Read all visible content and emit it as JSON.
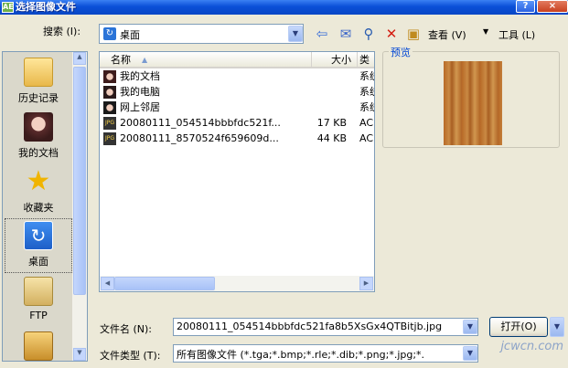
{
  "window": {
    "title": "选择图像文件",
    "app_icon": "AE",
    "help_button": "?",
    "close_button": "×"
  },
  "toolbar": {
    "search_label": "搜索 (I):",
    "location": "桌面",
    "view_label": "查看 (V)",
    "tools_label": "工具 (L)"
  },
  "places": [
    {
      "label": "历史记录",
      "icon": "history-folder-icon"
    },
    {
      "label": "我的文档",
      "icon": "my-documents-icon"
    },
    {
      "label": "收藏夹",
      "icon": "favorites-star-icon"
    },
    {
      "label": "桌面",
      "icon": "desktop-icon"
    },
    {
      "label": "FTP",
      "icon": "ftp-folder-icon"
    }
  ],
  "list": {
    "headers": {
      "name": "名称",
      "size": "大小",
      "type": "类"
    },
    "rows": [
      {
        "name": "我的文档",
        "size": "",
        "type": "系统"
      },
      {
        "name": "我的电脑",
        "size": "",
        "type": "系统"
      },
      {
        "name": "网上邻居",
        "size": "",
        "type": "系统"
      },
      {
        "name": "20080111_054514bbbfdc521f...",
        "size": "17 KB",
        "type": "ACD"
      },
      {
        "name": "20080111_8570524f659609d...",
        "size": "44 KB",
        "type": "ACD"
      }
    ]
  },
  "preview": {
    "label": "预览"
  },
  "bottom": {
    "filename_label": "文件名 (N):",
    "filename_value": "20080111_054514bbbfdc521fa8b5XsGx4QTBitjb.jpg",
    "filetype_label": "文件类型 (T):",
    "filetype_value": "所有图像文件 (*.tga;*.bmp;*.rle;*.dib;*.png;*.jpg;*.",
    "open_button": "打开(O)",
    "watermark": "jcwcn.com"
  },
  "colors": {
    "title_bar": "#0a4fd8",
    "dialog_bg": "#ece9d8",
    "field_border": "#7f9db9",
    "preview_label": "#0046d5"
  }
}
